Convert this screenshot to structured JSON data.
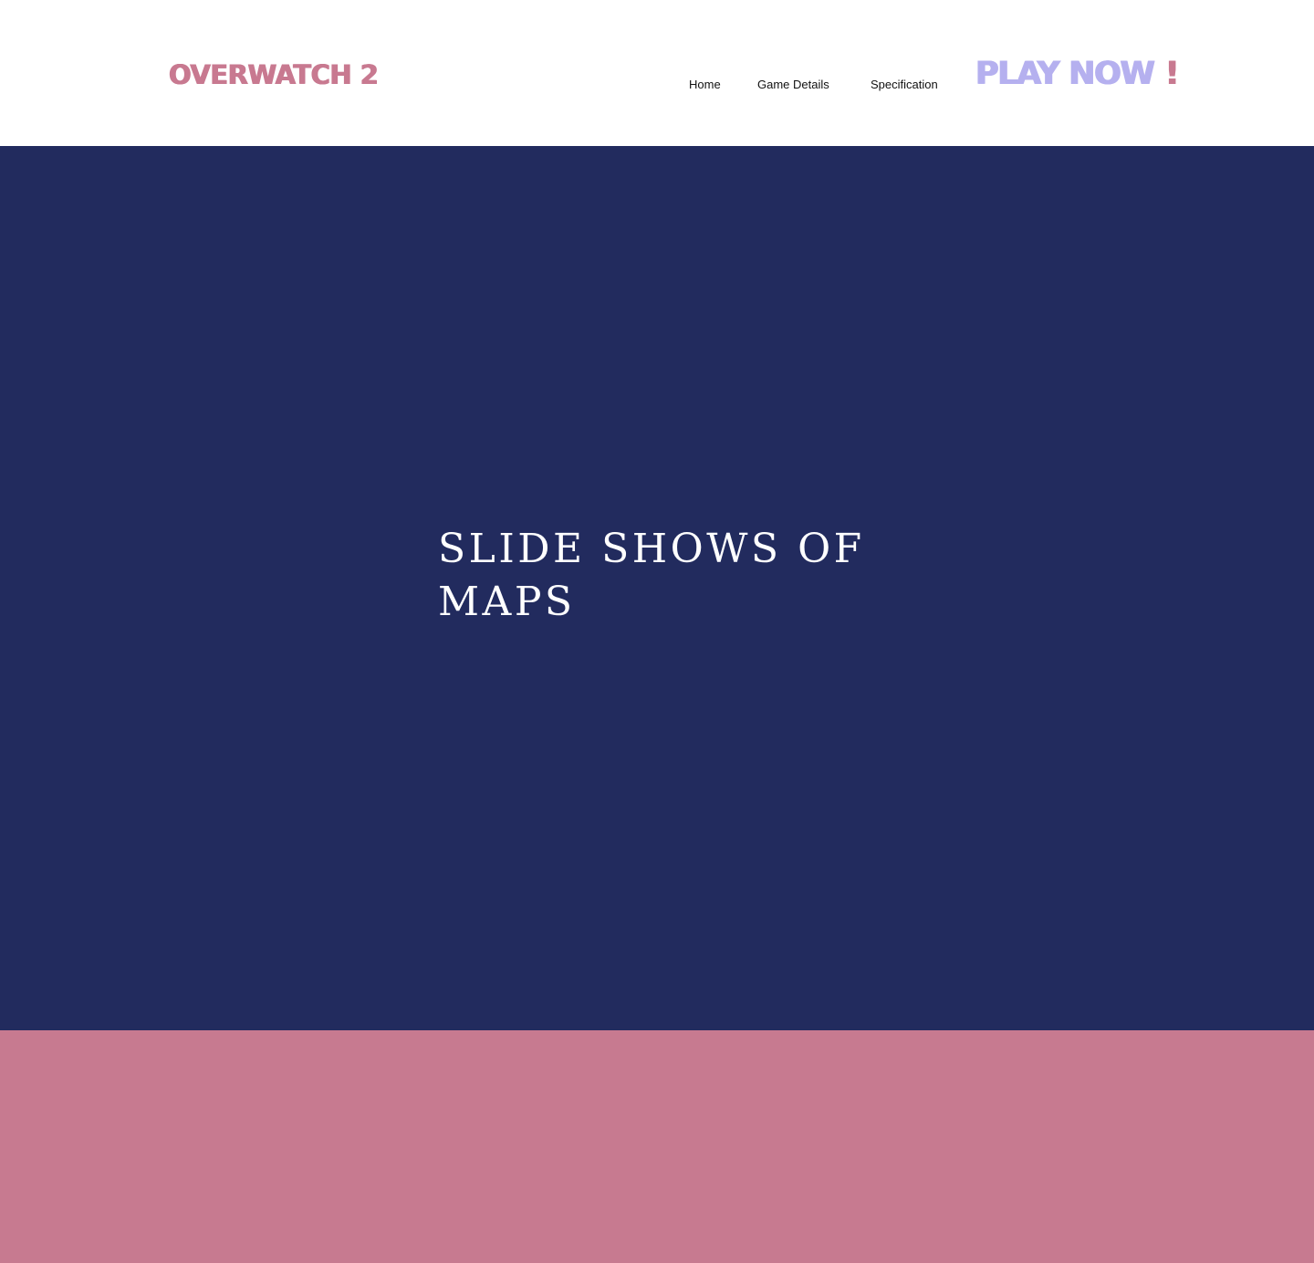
{
  "header": {
    "logo": "OVERWATCH 2",
    "nav": {
      "home": "Home",
      "game_details": "Game Details",
      "specification": "Specification"
    },
    "cta": {
      "label": "PLAY NOW",
      "accent": "!"
    }
  },
  "hero": {
    "title_line1": "SLIDE SHOWS OF",
    "title_line2": "MAPS"
  },
  "colors": {
    "brand_pink": "#c87990",
    "cta_lavender": "#b5b0ef",
    "hero_navy": "#222b5e",
    "footer_pink": "#c77a90",
    "header_bg": "#ffffff"
  }
}
